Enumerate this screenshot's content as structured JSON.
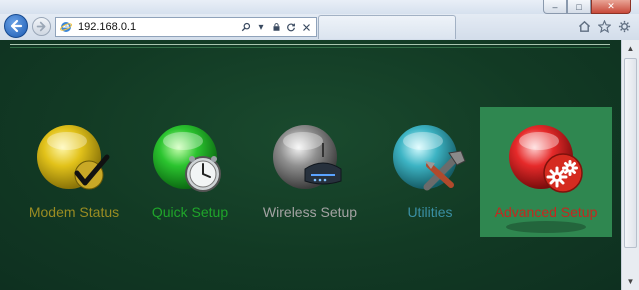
{
  "browser": {
    "address": "192.168.0.1",
    "window_controls": {
      "minimize": "–",
      "maximize": "□",
      "close": "✕"
    },
    "address_tools": [
      "search-icon",
      "dropdown-icon",
      "lock-icon",
      "refresh-icon",
      "stop-icon"
    ],
    "right_icons": [
      "home-icon",
      "favorites-icon",
      "tools-icon"
    ]
  },
  "menu": {
    "items": [
      {
        "id": "modem-status",
        "label": "Modem Status",
        "color": "#9a8c22",
        "icon": "modem-status-icon",
        "selected": false
      },
      {
        "id": "quick-setup",
        "label": "Quick Setup",
        "color": "#1fa52a",
        "icon": "quick-setup-icon",
        "selected": false
      },
      {
        "id": "wireless-setup",
        "label": "Wireless Setup",
        "color": "#a3a3a3",
        "icon": "wireless-setup-icon",
        "selected": false
      },
      {
        "id": "utilities",
        "label": "Utilities",
        "color": "#3a8fa3",
        "icon": "utilities-icon",
        "selected": false
      },
      {
        "id": "advanced-setup",
        "label": "Advanced Setup",
        "color": "#c4281f",
        "icon": "advanced-setup-icon",
        "selected": true
      }
    ]
  },
  "colors": {
    "page_background": "#123a24",
    "selected_background": "#2f8750"
  }
}
